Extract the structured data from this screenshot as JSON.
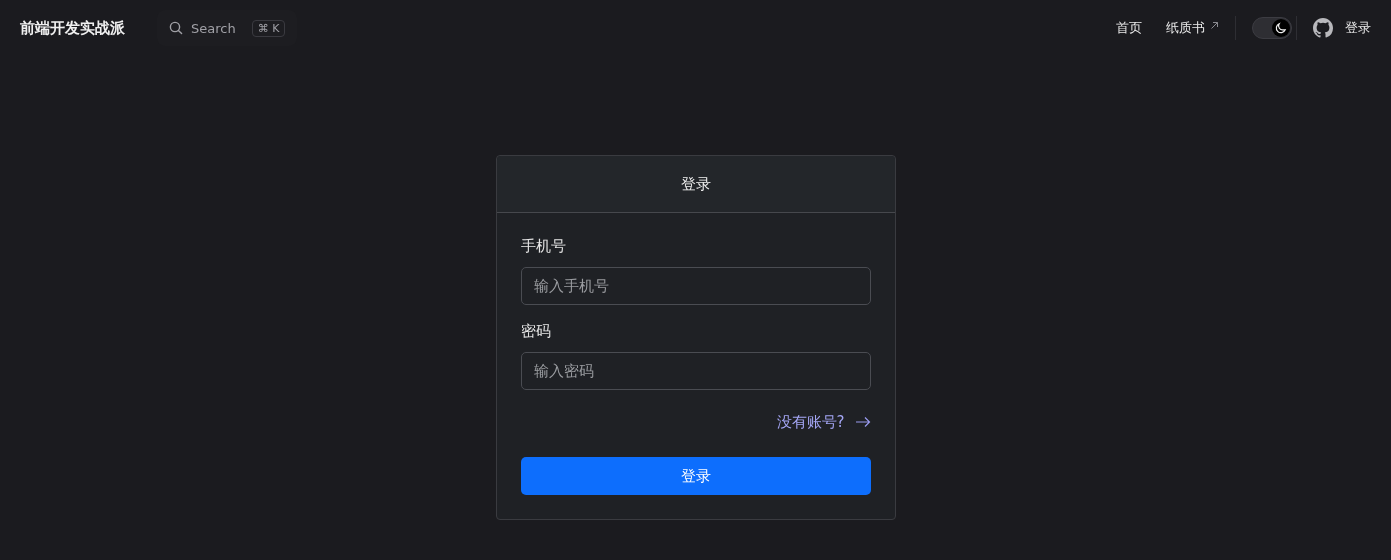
{
  "site_title": "前端开发实战派",
  "search": {
    "placeholder": "Search",
    "shortcut": "⌘ K"
  },
  "nav": [
    {
      "label": "首页",
      "external": false
    },
    {
      "label": "纸质书",
      "external": true
    }
  ],
  "theme_toggle": {
    "on": true
  },
  "login_link": "登录",
  "card": {
    "title": "登录",
    "fields": [
      {
        "label": "手机号",
        "placeholder": "输入手机号"
      },
      {
        "label": "密码",
        "placeholder": "输入密码"
      }
    ],
    "register_link": "没有账号?",
    "submit": "登录"
  }
}
